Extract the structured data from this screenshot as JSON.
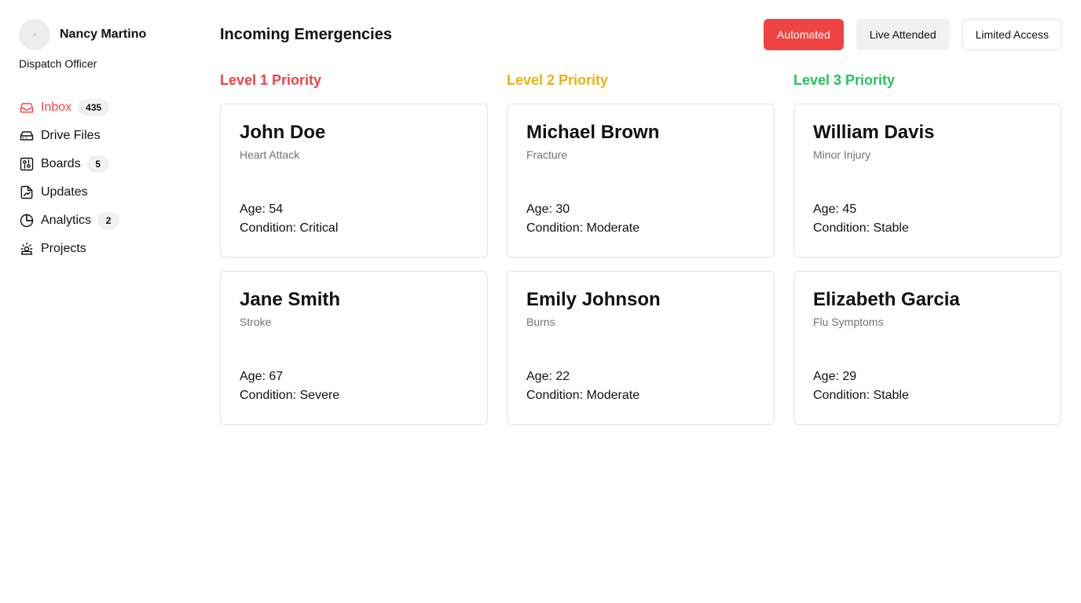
{
  "user": {
    "name": "Nancy Martino",
    "role": "Dispatch Officer"
  },
  "nav": [
    {
      "label": "Inbox",
      "badge": "435",
      "icon": "inbox-icon",
      "active": true
    },
    {
      "label": "Drive Files",
      "badge": null,
      "icon": "drive-icon",
      "active": false
    },
    {
      "label": "Boards",
      "badge": "5",
      "icon": "boards-icon",
      "active": false
    },
    {
      "label": "Updates",
      "badge": null,
      "icon": "updates-icon",
      "active": false
    },
    {
      "label": "Analytics",
      "badge": "2",
      "icon": "analytics-icon",
      "active": false
    },
    {
      "label": "Projects",
      "badge": null,
      "icon": "projects-icon",
      "active": false
    }
  ],
  "header": {
    "title": "Incoming Emergencies",
    "modes": [
      "Automated",
      "Live Attended",
      "Limited Access"
    ]
  },
  "levels": [
    {
      "title": "Level 1 Priority",
      "color": "#ef4444",
      "cards": [
        {
          "name": "John Doe",
          "issue": "Heart Attack",
          "age": "Age: 54",
          "condition": "Condition: Critical"
        },
        {
          "name": "Jane Smith",
          "issue": "Stroke",
          "age": "Age: 67",
          "condition": "Condition: Severe"
        }
      ]
    },
    {
      "title": "Level 2 Priority",
      "color": "#eab308",
      "cards": [
        {
          "name": "Michael Brown",
          "issue": "Fracture",
          "age": "Age: 30",
          "condition": "Condition: Moderate"
        },
        {
          "name": "Emily Johnson",
          "issue": "Burns",
          "age": "Age: 22",
          "condition": "Condition: Moderate"
        }
      ]
    },
    {
      "title": "Level 3 Priority",
      "color": "#22c55e",
      "cards": [
        {
          "name": "William Davis",
          "issue": "Minor Injury",
          "age": "Age: 45",
          "condition": "Condition: Stable"
        },
        {
          "name": "Elizabeth Garcia",
          "issue": "Flu Symptoms",
          "age": "Age: 29",
          "condition": "Condition: Stable"
        }
      ]
    }
  ],
  "colors": {
    "accent": "#ef4444",
    "level1": "#ef4444",
    "level2": "#eab308",
    "level3": "#22c55e"
  }
}
